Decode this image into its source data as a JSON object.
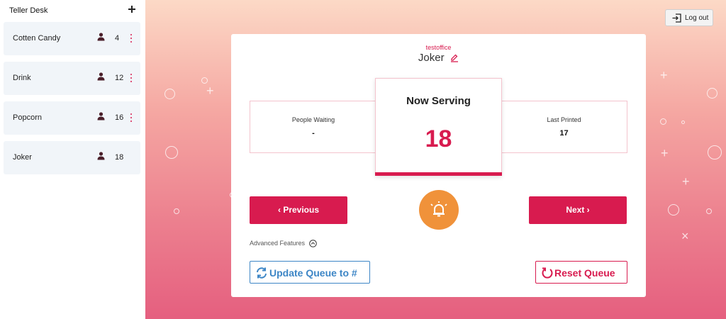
{
  "sidebar": {
    "title": "Teller Desk",
    "items": [
      {
        "name": "Cotten Candy",
        "count": "4",
        "has_menu": true
      },
      {
        "name": "Drink",
        "count": "12",
        "has_menu": true
      },
      {
        "name": "Popcorn",
        "count": "16",
        "has_menu": true
      },
      {
        "name": "Joker",
        "count": "18",
        "has_menu": false
      }
    ]
  },
  "header": {
    "logout_label": "Log out"
  },
  "card": {
    "office": "testoffice",
    "queue_name": "Joker",
    "people_waiting_label": "People Waiting",
    "people_waiting_value": "-",
    "now_serving_label": "Now Serving",
    "now_serving_value": "18",
    "last_printed_label": "Last Printed",
    "last_printed_value": "17",
    "previous_label": "Previous",
    "next_label": "Next",
    "advanced_label": "Advanced Features",
    "update_label": "Update Queue to #",
    "reset_label": "Reset Queue"
  },
  "colors": {
    "accent": "#d81b4f",
    "bell": "#f0923a",
    "update": "#3d86c6"
  },
  "icons": [
    "plus-icon",
    "person-icon",
    "kebab-menu-icon",
    "logout-icon",
    "edit-icon",
    "bell-icon",
    "chevron-up-circle-icon",
    "sync-icon",
    "reset-icon"
  ]
}
